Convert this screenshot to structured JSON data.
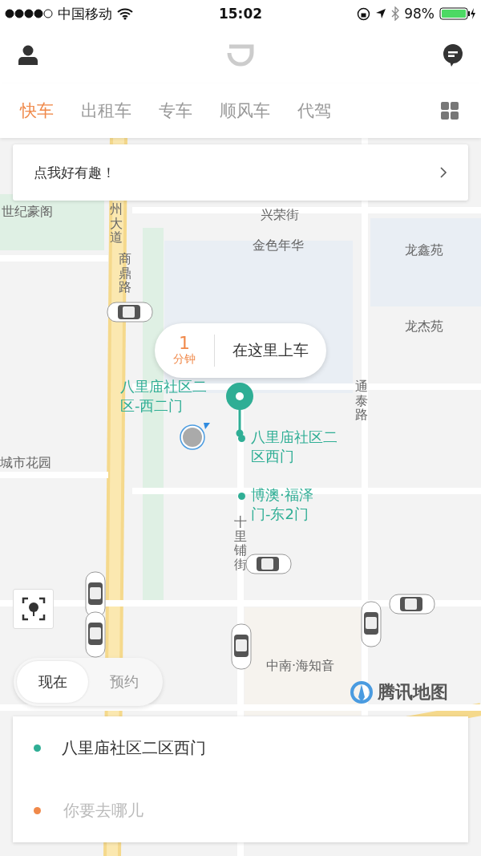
{
  "status_bar": {
    "carrier": "中国移动",
    "time": "15:02",
    "battery": "98%"
  },
  "tabs": [
    {
      "label": "快车",
      "selected": true
    },
    {
      "label": "出租车",
      "selected": false
    },
    {
      "label": "专车",
      "selected": false
    },
    {
      "label": "顺风车",
      "selected": false
    },
    {
      "label": "代驾",
      "selected": false
    }
  ],
  "banner": {
    "text": "点我好有趣！"
  },
  "map": {
    "labels": [
      {
        "text": "世纪豪阁",
        "kind": "horizontal"
      },
      {
        "text": "州大道",
        "kind": "vertical"
      },
      {
        "text": "兴荣街",
        "kind": "horizontal"
      },
      {
        "text": "金色年华",
        "kind": "horizontal"
      },
      {
        "text": "龙鑫苑",
        "kind": "horizontal"
      },
      {
        "text": "龙杰苑",
        "kind": "horizontal"
      },
      {
        "text": "商鼎路",
        "kind": "vertical"
      },
      {
        "text": "通泰路",
        "kind": "vertical"
      },
      {
        "text": "城市花园",
        "kind": "horizontal"
      },
      {
        "text": "十里铺街",
        "kind": "vertical"
      },
      {
        "text": "中南·海知音",
        "kind": "horizontal"
      }
    ],
    "stops": [
      {
        "text": "八里庙社区二区-西二门"
      },
      {
        "text": "八里庙社区二区西门"
      },
      {
        "text": "博澳·福泽门-东2门"
      }
    ],
    "pickup": {
      "eta": "1",
      "unit": "分钟",
      "text": "在这里上车"
    },
    "logo": "腾讯地图"
  },
  "time_mode": [
    {
      "label": "现在",
      "selected": true
    },
    {
      "label": "预约",
      "selected": false
    }
  ],
  "address": {
    "from": "八里庙社区二区西门",
    "to": {
      "placeholder": "你要去哪儿"
    }
  }
}
